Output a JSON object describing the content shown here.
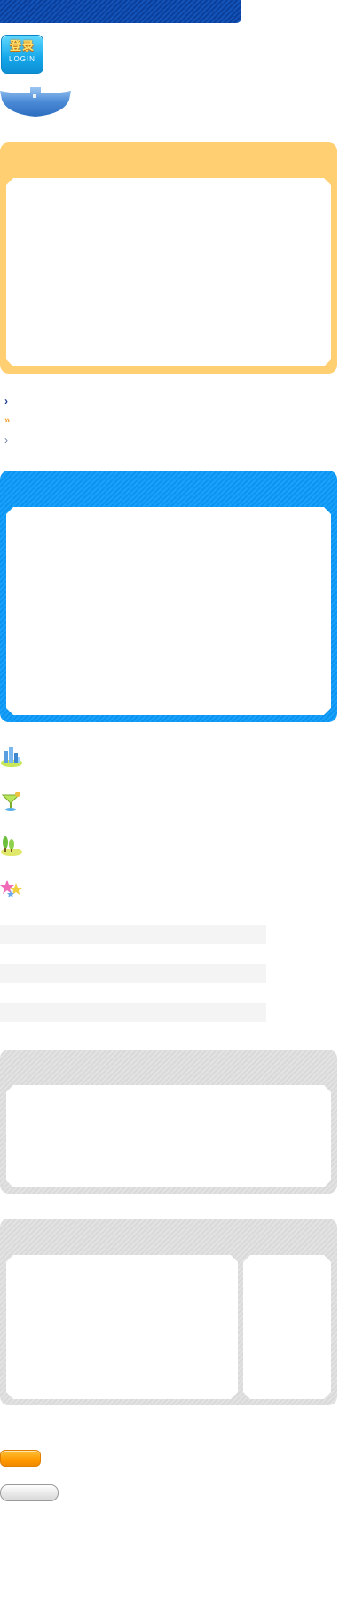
{
  "header": {
    "bar_color": "#0a3f9c"
  },
  "login": {
    "label_cn": "登录",
    "label_en": "LOGIN",
    "icon": "login-badge"
  },
  "tab": {
    "icon": "blue-tab-shape",
    "color": "#4a8ad6"
  },
  "panels": {
    "orange": {
      "color": "#ffcf72"
    },
    "blue": {
      "color": "#0b93f2"
    },
    "gray": {
      "color": "#dedede"
    }
  },
  "bullets": [
    {
      "icon": "chevron-right-dark",
      "color": "#1f3f8f"
    },
    {
      "icon": "double-chevron-orange",
      "color": "#f0a030"
    },
    {
      "icon": "chevron-right-light",
      "color": "#6a7fa8"
    }
  ],
  "icons": [
    {
      "icon": "city-buildings-icon"
    },
    {
      "icon": "cocktail-icon"
    },
    {
      "icon": "trees-icon"
    },
    {
      "icon": "stars-icon"
    }
  ],
  "buttons": {
    "orange": {
      "color": "#ff9a00"
    },
    "gray": {
      "color": "#e6e6e6"
    }
  }
}
